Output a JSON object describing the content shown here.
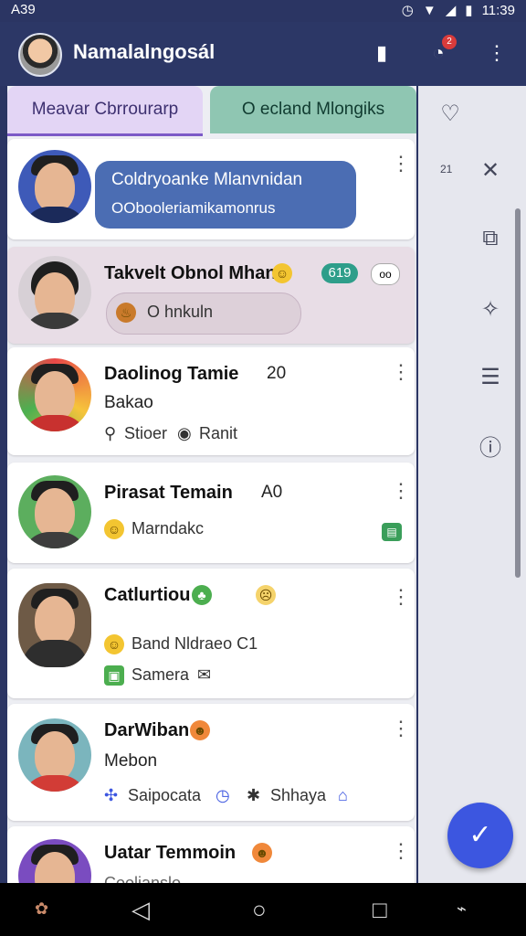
{
  "status": {
    "left_text": "A39",
    "time": "11:39"
  },
  "appbar": {
    "title": "Namalalngosál",
    "badge": "2"
  },
  "tabs": [
    {
      "label": "Meavar Cbrrourarp"
    },
    {
      "label": "O ecland Mlongiks"
    }
  ],
  "cards": [
    {
      "bubble_line1": "Coldryoanke Mlanvnidan",
      "bubble_line2": "OObooleriamikamonrus"
    },
    {
      "name": "Takvelt Obnol Mhan",
      "tag": "619",
      "message": "O hnkuln"
    },
    {
      "name": "Daolinog Tamie",
      "count": "20",
      "sub": "Bakao",
      "meta1": "Stioer",
      "meta2": "Ranit"
    },
    {
      "name": "Pirasat Temain",
      "count": "A0",
      "sub": "Marndakc"
    },
    {
      "name": "Catlurtiou",
      "line1": "Band Nldraeo C1",
      "line2": "Samera"
    },
    {
      "name": "DarWiban",
      "sub": "Mebon",
      "meta1": "Saipocata",
      "meta2": "Shhaya"
    },
    {
      "name": "Uatar Temmoin",
      "sub": "Coolianslo"
    }
  ],
  "colors": {
    "appbar": "#2c3766",
    "accent": "#3c56e0",
    "tab_active": "#e3d5f5",
    "tab_other": "#8fc6b2"
  },
  "sidebar": {
    "icons": [
      "heart-outline-icon",
      "close-icon",
      "share-box-icon",
      "puzzle-icon",
      "document-icon",
      "info-icon"
    ],
    "small_text": "21"
  }
}
